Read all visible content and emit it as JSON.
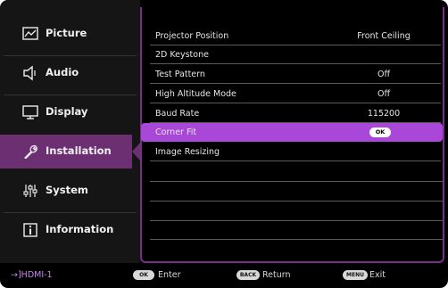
{
  "sidebar": {
    "items": [
      {
        "label": "Picture",
        "icon": "picture-monitor-icon"
      },
      {
        "label": "Audio",
        "icon": "speaker-icon"
      },
      {
        "label": "Display",
        "icon": "display-monitor-icon"
      },
      {
        "label": "Installation",
        "icon": "wrench-icon",
        "active": true
      },
      {
        "label": "System",
        "icon": "sliders-icon"
      },
      {
        "label": "Information",
        "icon": "info-icon"
      }
    ]
  },
  "menu": {
    "rows": [
      {
        "label": "Projector Position",
        "value": "Front Ceiling"
      },
      {
        "label": "2D Keystone",
        "value": ""
      },
      {
        "label": "Test Pattern",
        "value": "Off"
      },
      {
        "label": "High Altitude Mode",
        "value": "Off"
      },
      {
        "label": "Baud Rate",
        "value": "115200"
      },
      {
        "label": "Corner Fit",
        "value": "OK",
        "selected": true
      },
      {
        "label": "Image Resizing",
        "value": ""
      }
    ]
  },
  "footer": {
    "source": "HDMI-1",
    "ok_key": "OK",
    "ok_label": "Enter",
    "back_key": "BACK",
    "back_label": "Return",
    "menu_key": "MENU",
    "menu_label": "Exit"
  },
  "colors": {
    "accent": "#a847d8",
    "active_sidebar": "#6c2f72",
    "frame": "#7b2d8c"
  }
}
